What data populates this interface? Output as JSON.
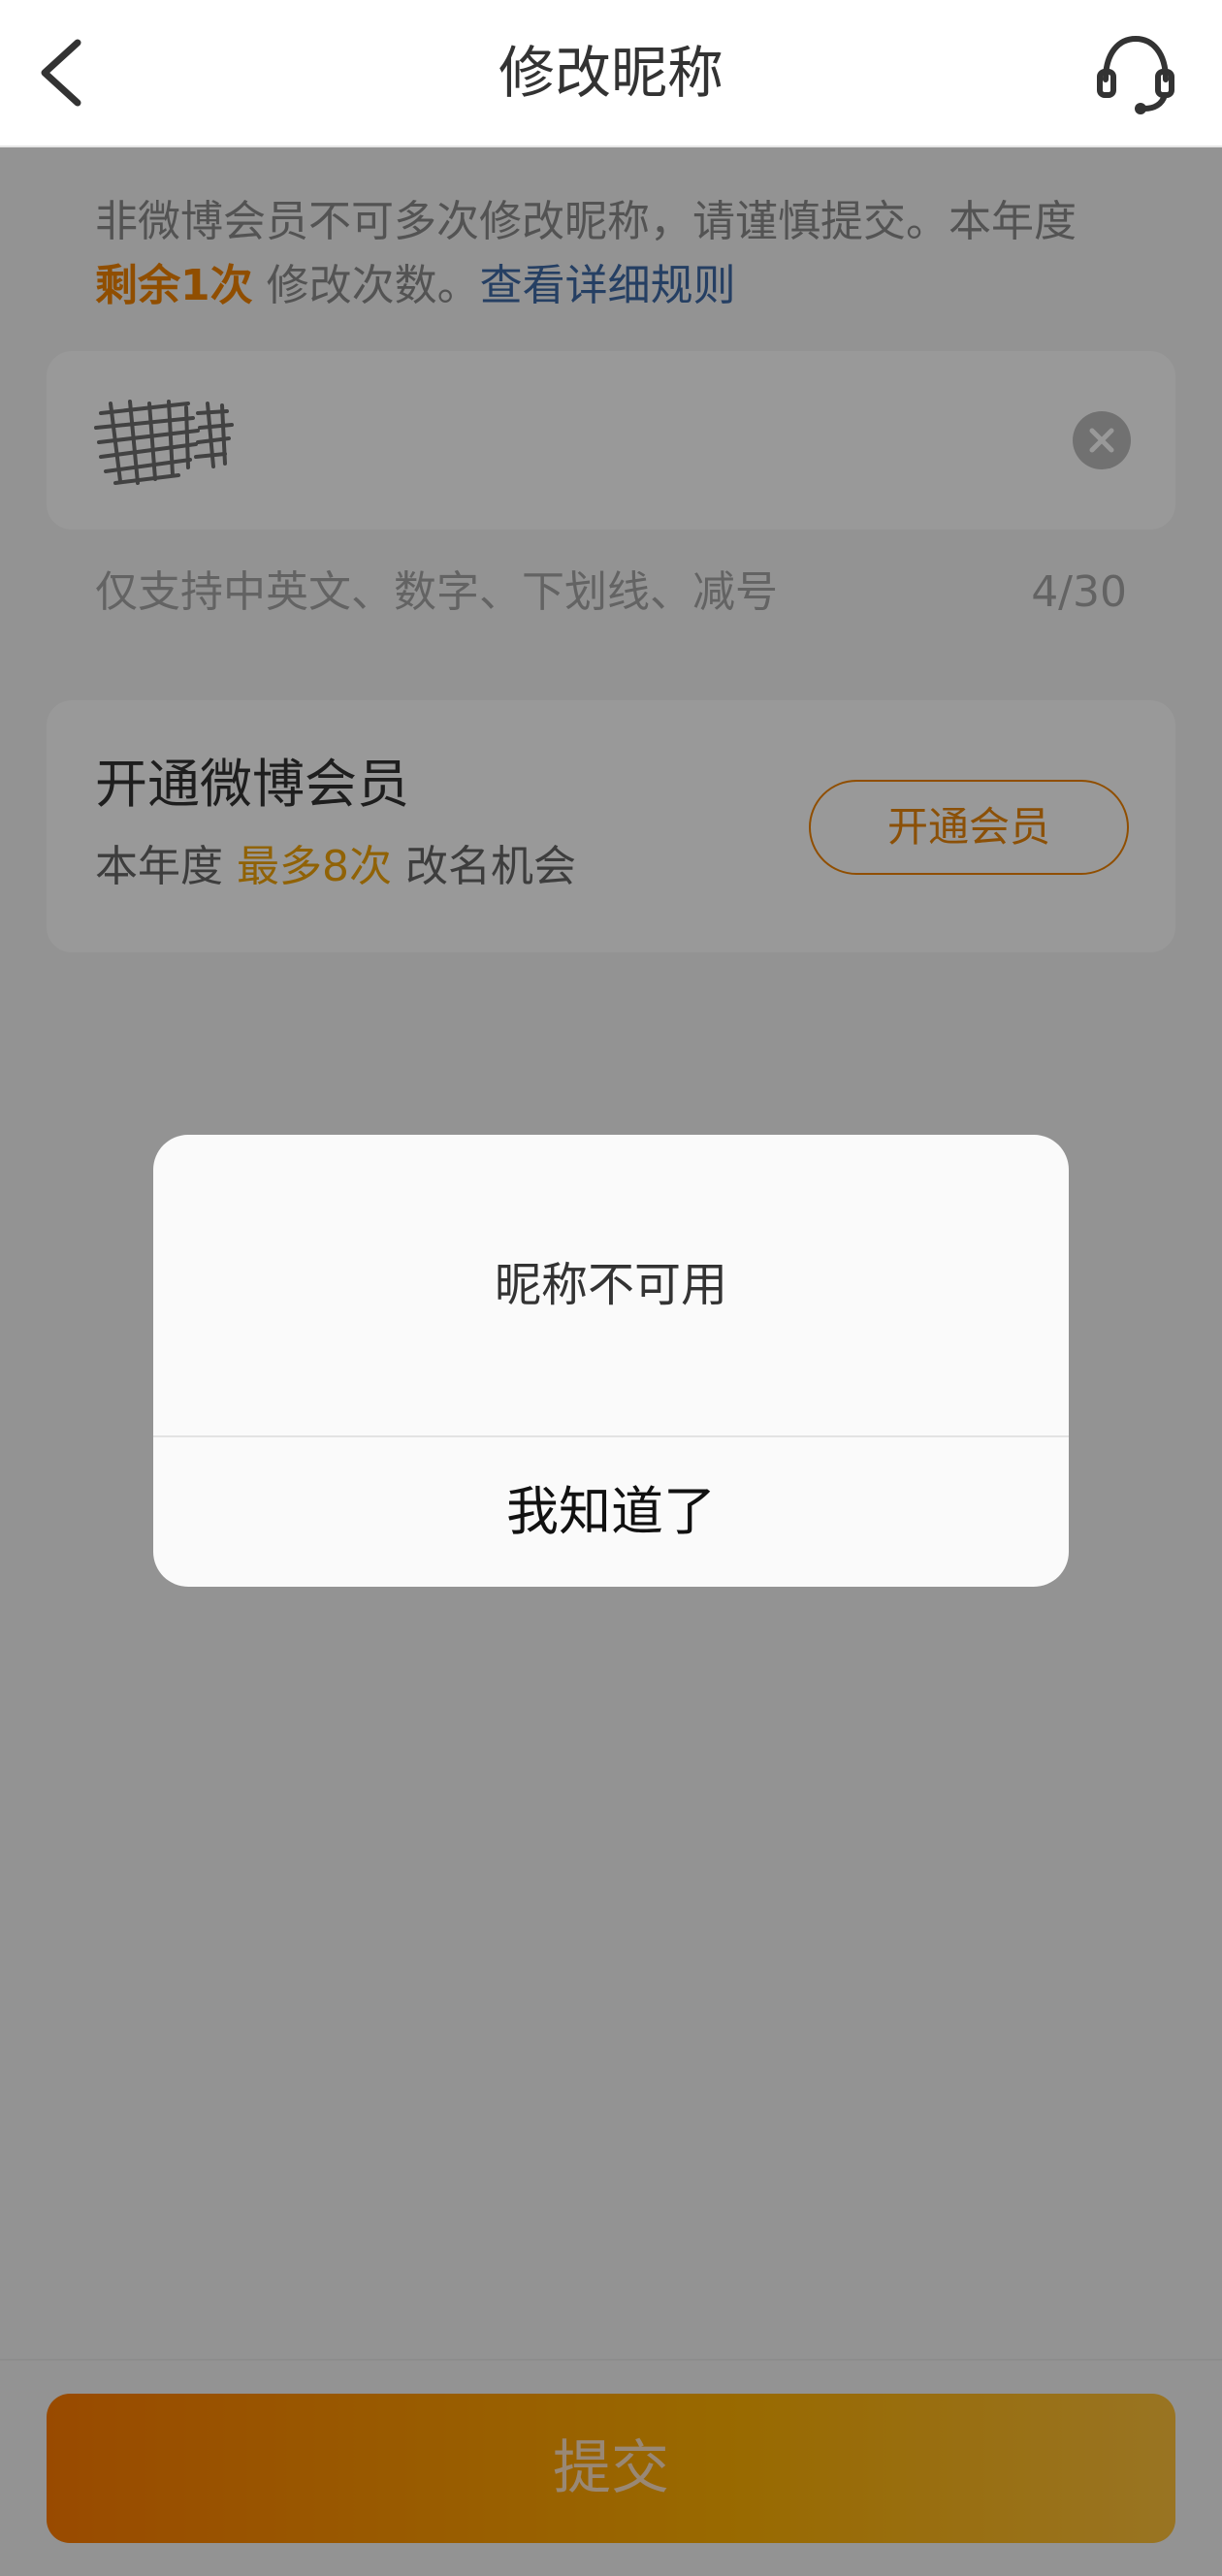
{
  "header": {
    "title": "修改昵称",
    "back_icon": "chevron-left-icon",
    "service_icon": "headset-icon"
  },
  "notice": {
    "text_prefix": "非微博会员不可多次修改昵称，请谨慎提交。本年度",
    "remaining": "剩余1次",
    "text_suffix": " 修改次数。",
    "rules_link": "查看详细规则"
  },
  "nickname_field": {
    "clear_icon": "close-circle-icon"
  },
  "hint": {
    "text": "仅支持中英文、数字、下划线、减号",
    "count": "4/30"
  },
  "vip": {
    "title": "开通微博会员",
    "sub_prefix": "本年度 ",
    "sub_highlight": "最多8次",
    "sub_suffix": " 改名机会",
    "button": "开通会员"
  },
  "submit": {
    "label": "提交"
  },
  "dialog": {
    "message": "昵称不可用",
    "confirm": "我知道了"
  },
  "colors": {
    "accent": "#f08300",
    "link": "#3f6aa6",
    "submit_gradient_start": "#ff7c00",
    "submit_gradient_end": "#ffc23a"
  }
}
